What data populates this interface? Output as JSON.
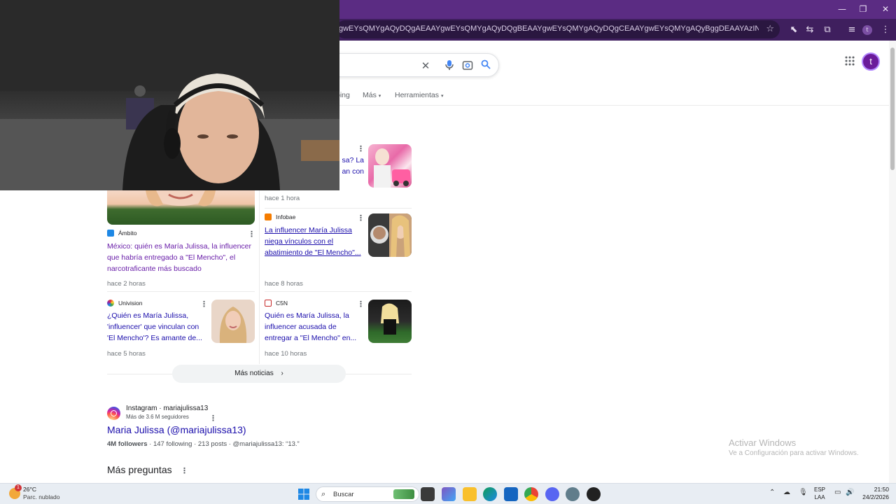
{
  "browser": {
    "url": "gwEYsQMYgAQyDQgAEAAYgwEYsQMYgAQyDQgBEAAYgwEYsQMYgAQyDQgCEAAYgwEYsQMYgAQyBggDEAAYAzINCAQQABiDARixAxiABDINCAU...",
    "window_controls": {
      "minimize": "—",
      "restore": "❐",
      "close": "✕"
    }
  },
  "search": {
    "clear_icon": "✕",
    "apps_icon": "⋮⋮⋮",
    "account_initial": "t"
  },
  "tabs": [
    {
      "label": "ping"
    },
    {
      "label": "Más"
    },
    {
      "label": "Herramientas"
    }
  ],
  "news": {
    "items": [
      {
        "source": "",
        "headline_partial_1": "sa? La",
        "headline_partial_2": "an con",
        "age": "hace 1 hora"
      },
      {
        "source": "Ámbito",
        "headline": "México: quién es María Julissa, la influencer que habría entregado a \"El Mencho\", el narcotraficante más buscado",
        "age": "hace 2 horas"
      },
      {
        "source": "Infobae",
        "headline": "La influencer María Julissa niega vínculos con el abatimiento de \"El Mencho\"...",
        "age": "hace 8 horas"
      },
      {
        "source": "Univision",
        "headline": "¿Quién es María Julissa, 'influencer' que vinculan con 'El Mencho'? Es amante de...",
        "age": "hace 5 horas"
      },
      {
        "source": "C5N",
        "headline": "Quién es María Julissa, la influencer acusada de entregar a \"El Mencho\" en...",
        "age": "hace 10 horas"
      }
    ],
    "more_label": "Más noticias"
  },
  "instagram": {
    "site": "Instagram · mariajulissa13",
    "followers_line": "Más de 3.6 M seguidores",
    "title": "Maria Julissa (@mariajulissa13)",
    "stats_bold": "4M followers",
    "stats_rest": " · 147 following · 213 posts · @mariajulissa13: “13.”"
  },
  "people_also_ask": "Más preguntas",
  "activation": {
    "line1": "Activar Windows",
    "line2": "Ve a Configuración para activar Windows."
  },
  "taskbar": {
    "weather_badge": "1",
    "temp": "26°C",
    "condition": "Parc. nublado",
    "search_label": "Buscar",
    "lang_1": "ESP",
    "lang_2": "LAA",
    "time": "21:50",
    "date": "24/2/2026"
  },
  "colors": {
    "title_bar": "#5b2c83",
    "link": "#1a0dab",
    "visited": "#681da8"
  }
}
